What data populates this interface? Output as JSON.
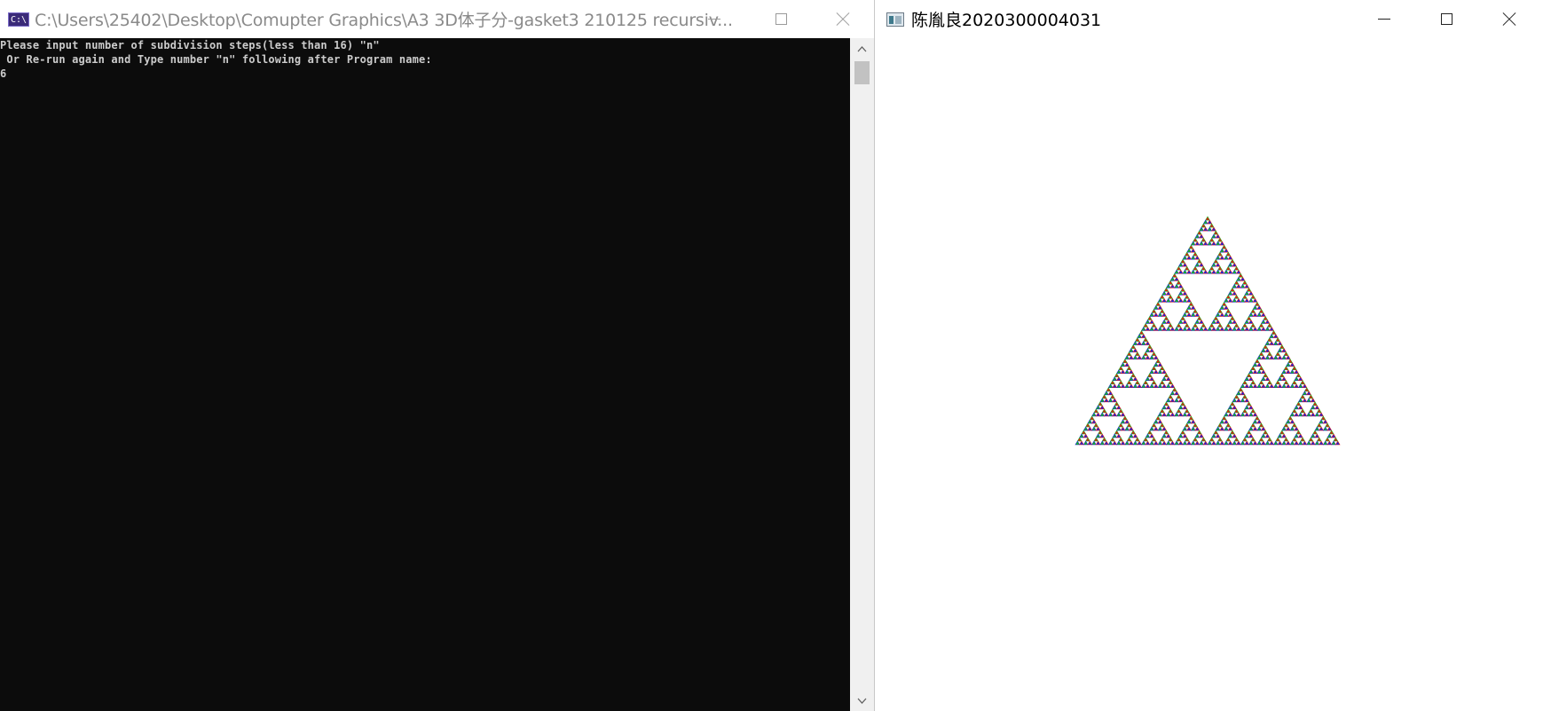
{
  "console": {
    "title": "C:\\Users\\25402\\Desktop\\Comupter Graphics\\A3 3D体子分-gasket3 210125 recursiv...",
    "icon": "console-app-icon",
    "icon_text": "C:\\",
    "lines": [
      "Please input number of subdivision steps(less than 16) \"n\"",
      " Or Re-run again and Type number \"n\" following after Program name:",
      "6"
    ]
  },
  "gl_window": {
    "title": "陈胤良2020300004031",
    "icon": "application-window-icon",
    "figure": {
      "shape": "sierpinski-gasket",
      "subdivision_steps": 6,
      "colors": [
        "#e01818",
        "#18b818",
        "#1828d8"
      ]
    }
  },
  "caption_buttons": [
    "minimize",
    "maximize",
    "close"
  ]
}
